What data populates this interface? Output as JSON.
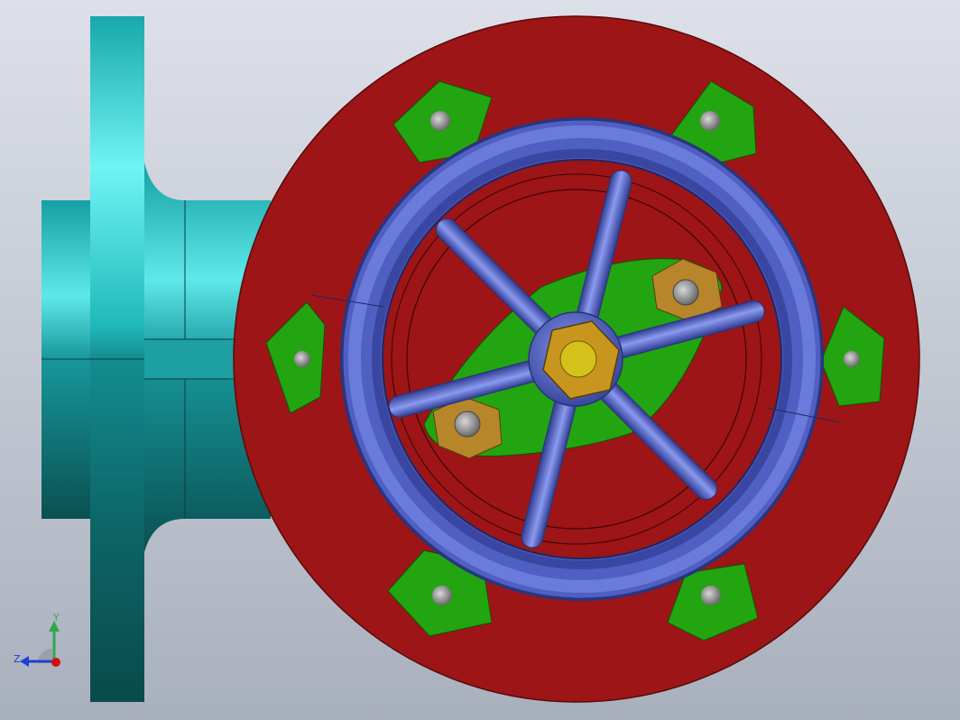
{
  "viewport": {
    "background_top": "#d7dbe4",
    "background_bottom": "#aab1be"
  },
  "model": {
    "body_color": "#1aa3a6",
    "flange_color": "#9b1517",
    "gasket_color": "#1ea30e",
    "handwheel_color": "#5566c8",
    "nut_color": "#b8862a",
    "bolt_color": "#9a9a9a",
    "center_nut_color": "#c8961e"
  },
  "triad": {
    "y_label": "Y",
    "z_label": "Z",
    "y_color": "#2ea84a",
    "z_color": "#1f3fd6",
    "x_color": "#d01010"
  }
}
